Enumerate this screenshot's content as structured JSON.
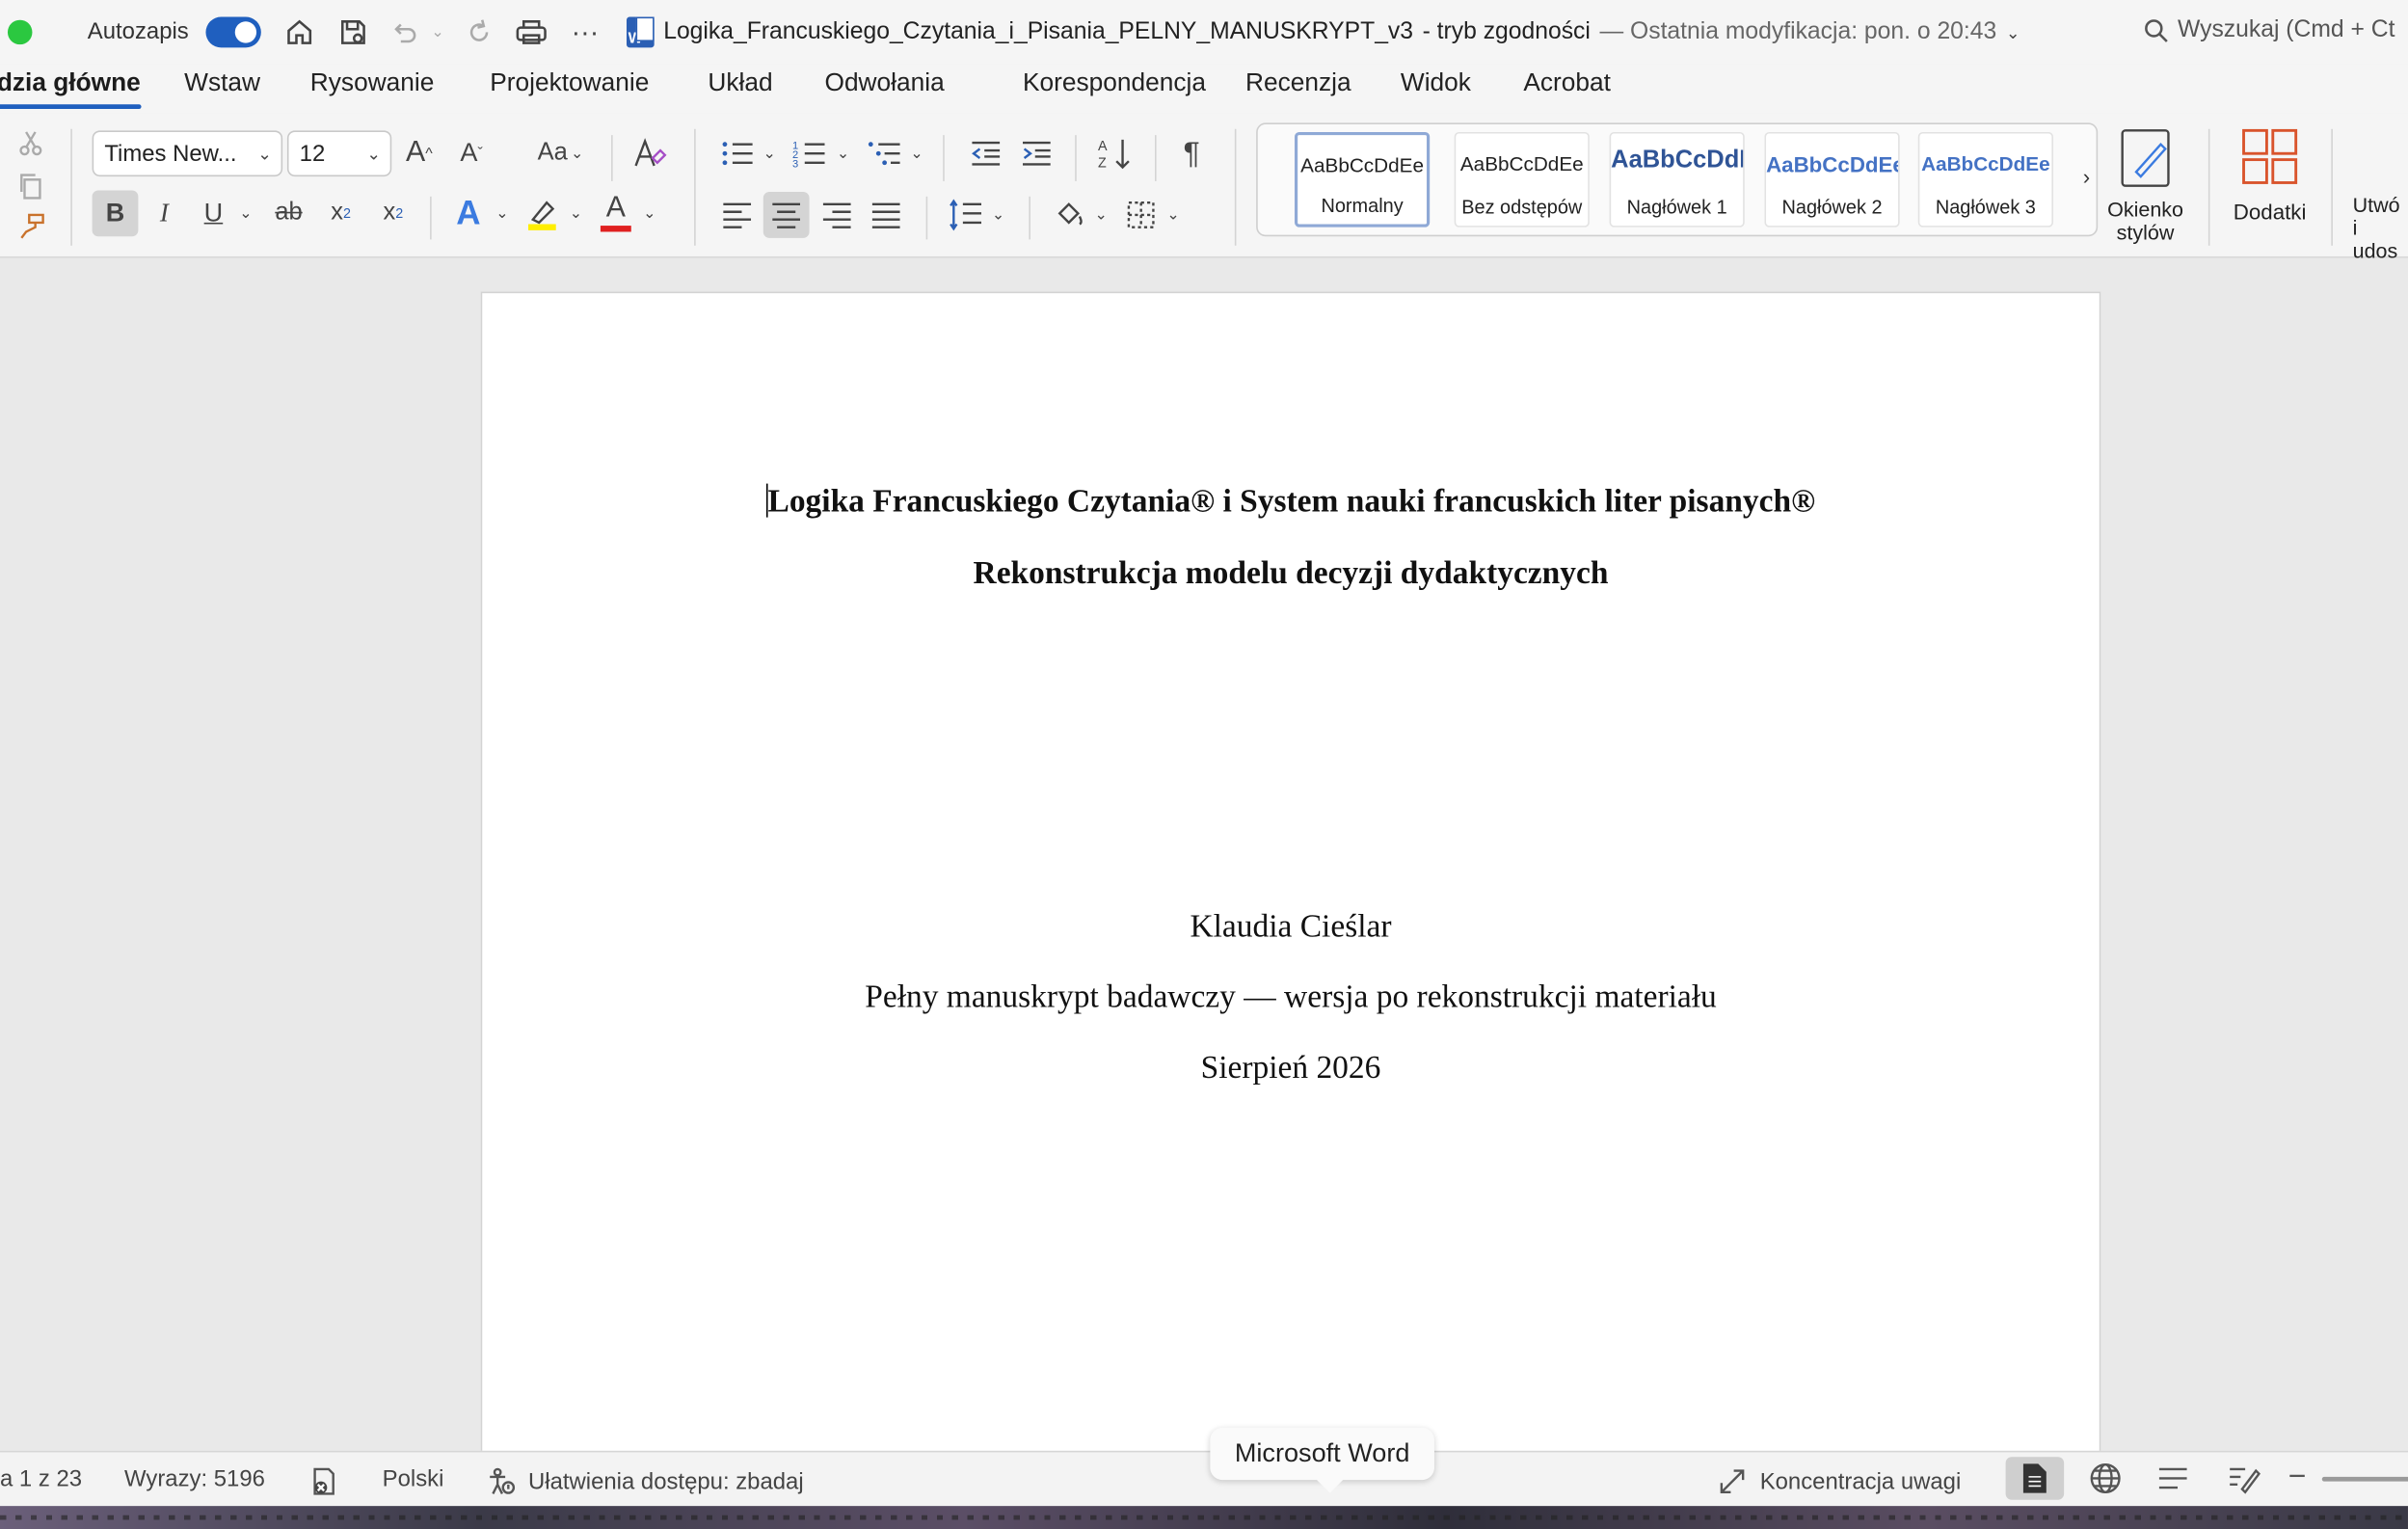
{
  "titlebar": {
    "autosave_label": "Autozapis",
    "doc_name": "Logika_Francuskiego_Czytania_i_Pisania_PELNY_MANUSKRYPT_v3",
    "mode": " -  tryb zgodności",
    "modified": "— Ostatnia modyfikacja: pon. o 20:43",
    "search_placeholder": "Wyszukaj (Cmd + Ct"
  },
  "tabs": [
    "dzia główne",
    "Wstaw",
    "Rysowanie",
    "Projektowanie",
    "Układ",
    "Odwołania",
    "Korespondencja",
    "Recenzja",
    "Widok",
    "Acrobat"
  ],
  "ribbon": {
    "font_name": "Times New...",
    "font_size": "12",
    "change_case": "Aa",
    "styles": [
      {
        "preview": "AaBbCcDdEe",
        "name": "Normalny",
        "color": "#222222"
      },
      {
        "preview": "AaBbCcDdEe",
        "name": "Bez odstępów",
        "color": "#222222"
      },
      {
        "preview": "AaBbCcDdE",
        "name": "Nagłówek 1",
        "color": "#2f5496"
      },
      {
        "preview": "AaBbCcDdEe",
        "name": "Nagłówek 2",
        "color": "#4472c4"
      },
      {
        "preview": "AaBbCcDdEe",
        "name": "Nagłówek 3",
        "color": "#4472c4"
      }
    ],
    "styles_pane": "Okienko stylów",
    "addins": "Dodatki",
    "create_share": "Utwó i udos"
  },
  "document": {
    "title_line1": "Logika Francuskiego Czytania® i System nauki francuskich liter pisanych®",
    "title_line2": "Rekonstrukcja modelu decyzji dydaktycznych",
    "author": "Klaudia Cieślar",
    "subtitle": "Pełny manuskrypt badawczy — wersja po rekonstrukcji materiału",
    "date": "Sierpień 2026"
  },
  "statusbar": {
    "page": "a 1 z 23",
    "words": "Wyrazy: 5196",
    "language": "Polski",
    "accessibility": "Ułatwienia dostępu: zbadaj",
    "focus": "Koncentracja uwagi"
  },
  "tooltip": "Microsoft Word",
  "colors": {
    "accent": "#1f5fbf",
    "highlight": "#ffff00",
    "font_color": "#e02020",
    "addins_icon": "#d9542c"
  }
}
